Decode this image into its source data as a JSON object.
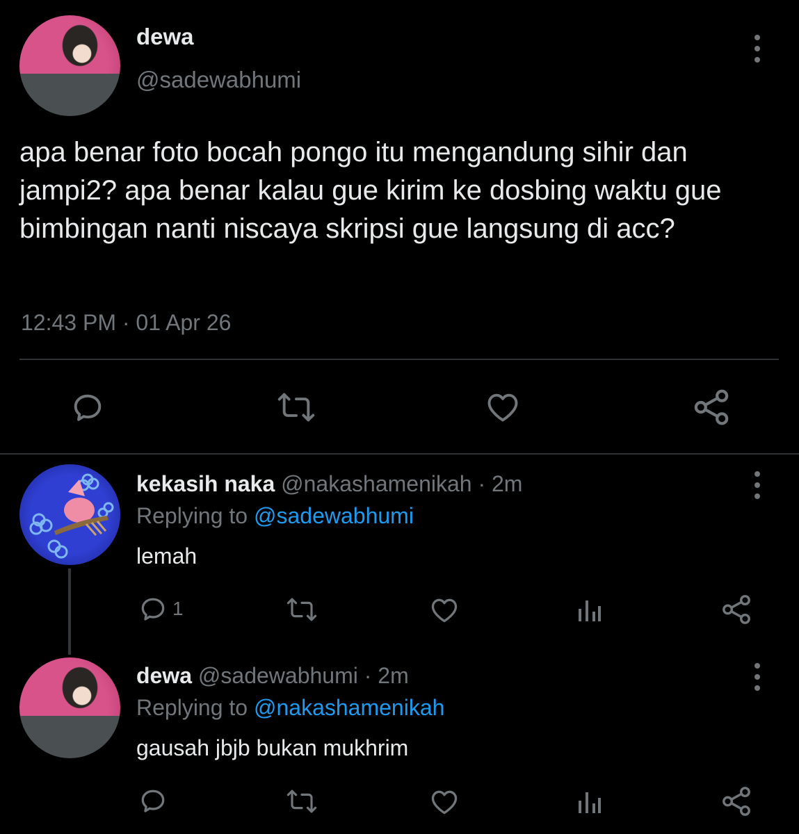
{
  "main_tweet": {
    "author_name": "dewa",
    "author_handle": "@sadewabhumi",
    "text": "apa benar foto bocah pongo itu mengandung sihir dan jampi2? apa benar kalau gue kirim ke dosbing waktu gue bimbingan nanti niscaya skripsi gue langsung di acc?",
    "timestamp": "12:43 PM · 01 Apr 26",
    "actions": [
      "reply-icon",
      "retweet-icon",
      "like-icon",
      "share-icon"
    ]
  },
  "replies": [
    {
      "author_name": "kekasih naka",
      "author_handle": "@nakashamenikah",
      "separator": "·",
      "time": "2m",
      "replying_prefix": "Replying to",
      "replying_to": "@sadewabhumi",
      "text": "lemah",
      "reply_count": "1",
      "actions": [
        "reply-icon",
        "retweet-icon",
        "like-icon",
        "analytics-icon",
        "share-icon"
      ]
    },
    {
      "author_name": "dewa",
      "author_handle": "@sadewabhumi",
      "separator": "·",
      "time": "2m",
      "replying_prefix": "Replying to",
      "replying_to": "@nakashamenikah",
      "text": "gausah jbjb bukan mukhrim",
      "actions": [
        "reply-icon",
        "retweet-icon",
        "like-icon",
        "analytics-icon",
        "share-icon"
      ]
    }
  ],
  "colors": {
    "background": "#000000",
    "text": "#e7e9ea",
    "secondary": "#71767b",
    "accent": "#1d9bf0",
    "divider": "#2f3336"
  }
}
